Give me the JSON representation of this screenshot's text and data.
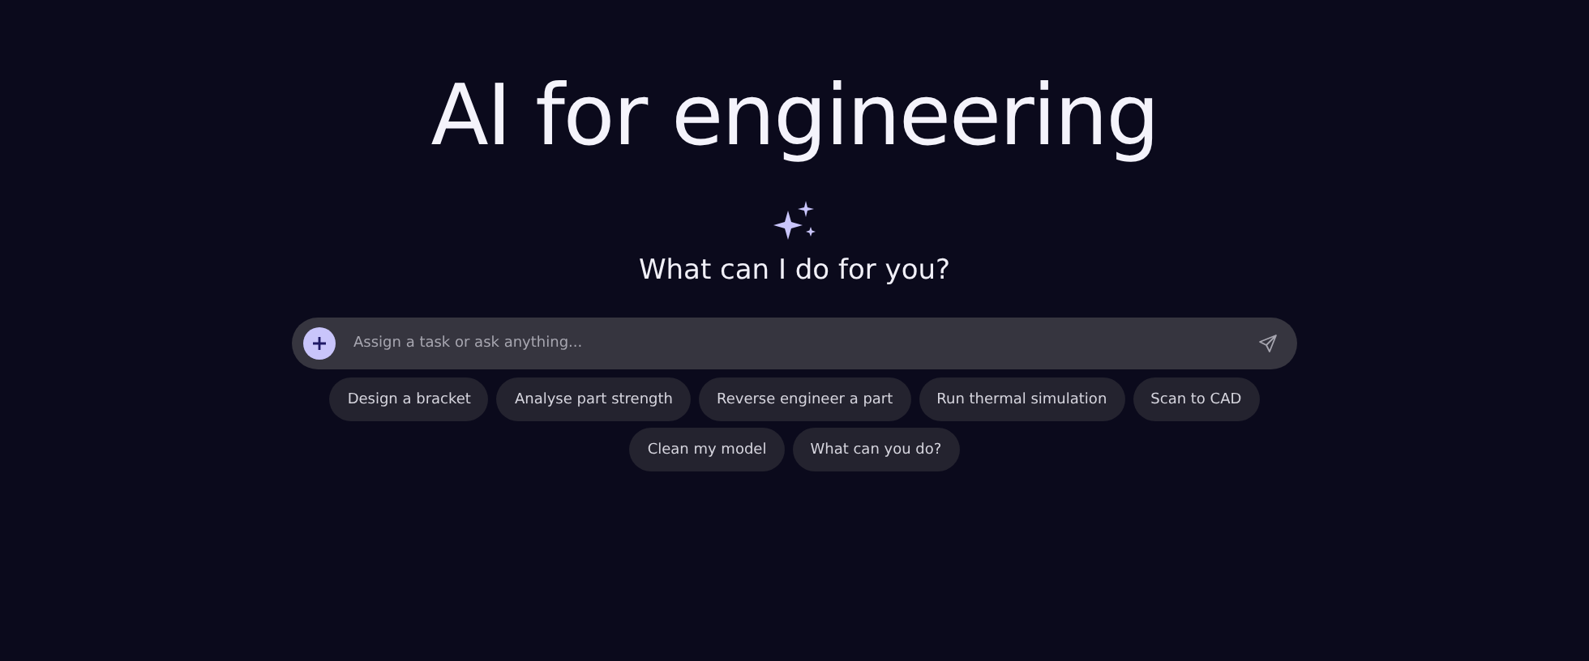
{
  "headline": "AI for engineering",
  "prompt": "What can I do for you?",
  "input": {
    "placeholder": "Assign a task or ask anything..."
  },
  "suggestions": [
    [
      "Design a bracket",
      "Analyse part strength",
      "Reverse engineer a part",
      "Run thermal simulation",
      "Scan to CAD"
    ],
    [
      "Clean my model",
      "What can you do?"
    ]
  ]
}
